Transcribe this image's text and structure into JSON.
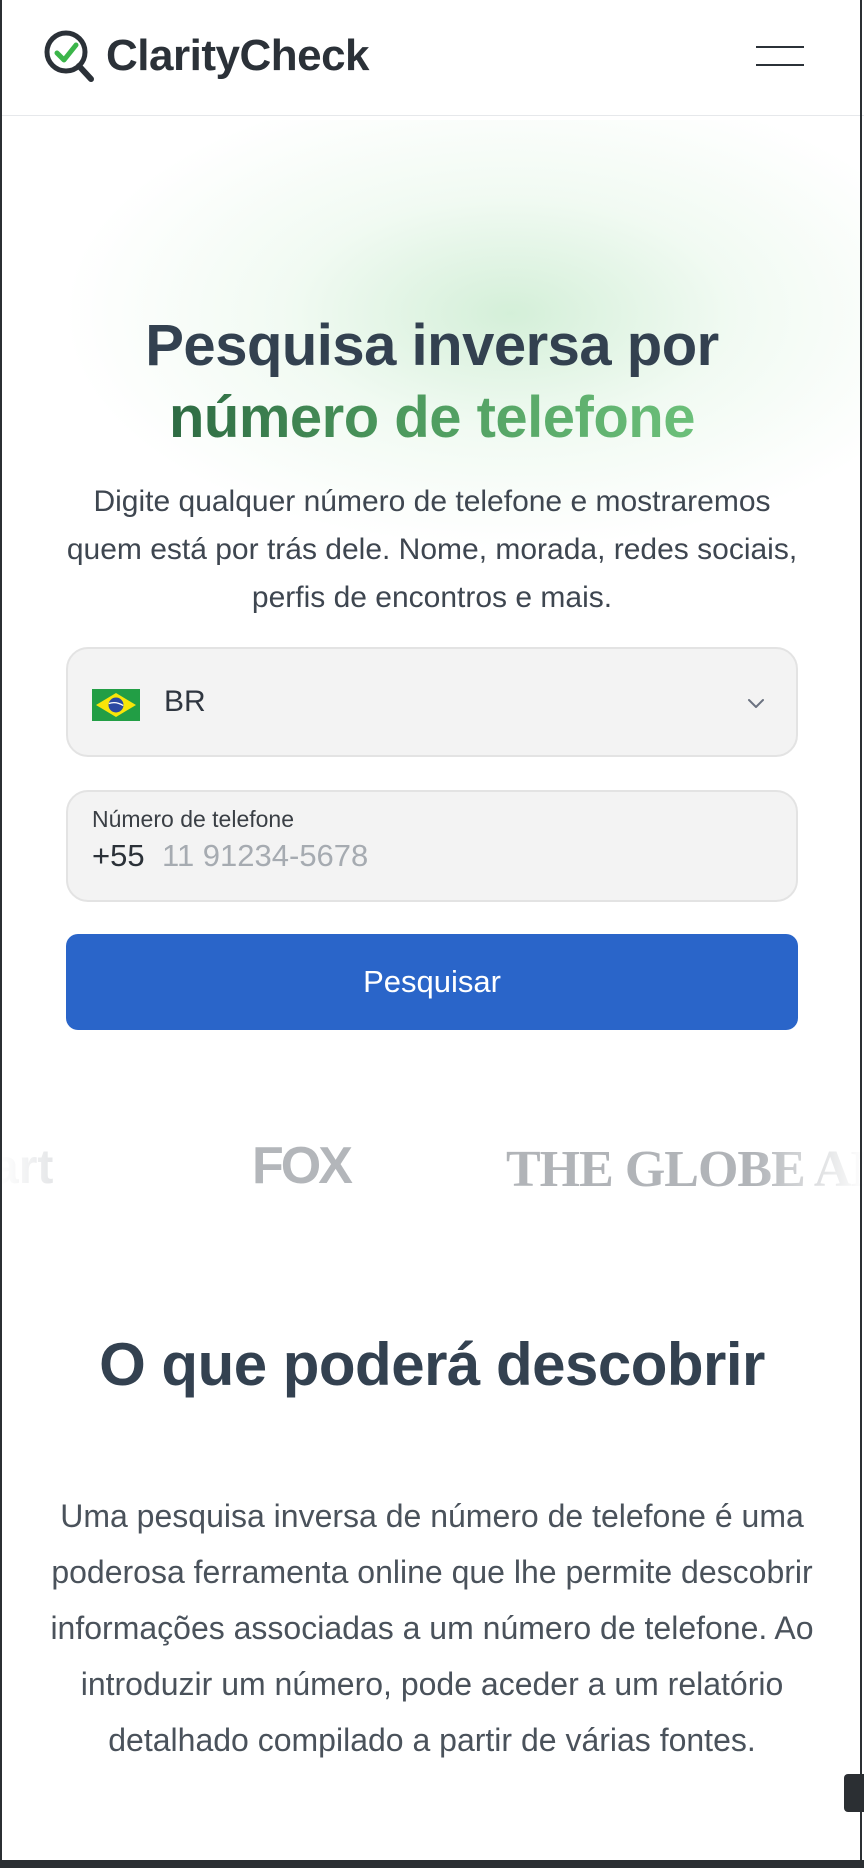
{
  "header": {
    "logo_text": "ClarityCheck",
    "logo_icon": "magnifier-check-icon",
    "menu_icon": "hamburger-menu-icon"
  },
  "hero": {
    "title_line1": "Pesquisa inversa por",
    "title_line2": "número de telefone",
    "subtitle": "Digite qualquer número de telefone e mostraremos quem está por trás dele. Nome, morada, redes sociais, perfis de encontros e mais."
  },
  "form": {
    "country": {
      "flag_icon": "brazil-flag-icon",
      "code": "BR",
      "chevron_icon": "chevron-down-icon"
    },
    "phone": {
      "label": "Número de telefone",
      "prefix": "+55",
      "placeholder": "11 91234-5678",
      "value": ""
    },
    "submit_label": "Pesquisar"
  },
  "press": {
    "logos": [
      "art",
      "FOX",
      "THE GLOBE AN"
    ]
  },
  "discover": {
    "title": "O que poderá descobrir",
    "body": "Uma pesquisa inversa de número de telefone é uma poderosa ferramenta online que lhe permite descobrir informações associadas a um número de telefone. Ao introduzir um número, pode aceder a um relatório detalhado compilado a partir de várias fontes."
  },
  "colors": {
    "primary_button": "#2a65c9",
    "accent_green": "#4d9a5e",
    "heading": "#334150"
  }
}
